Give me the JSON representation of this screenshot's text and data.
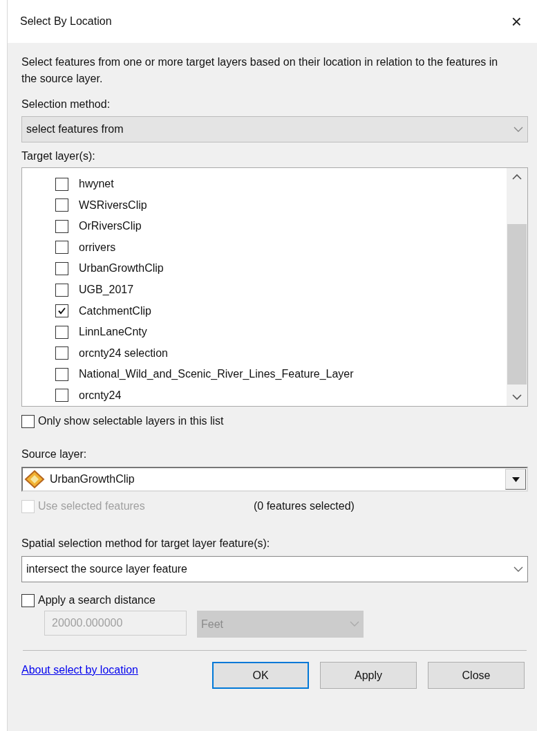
{
  "window": {
    "title": "Select By Location",
    "close": "×"
  },
  "description": "Select features from one or more target layers based on their location in relation to the features in the source layer.",
  "selection_method": {
    "label": "Selection method:",
    "value": "select features from"
  },
  "target_layers": {
    "label": "Target layer(s):",
    "items": [
      {
        "name": "hwynet",
        "checked": false
      },
      {
        "name": "WSRiversClip",
        "checked": false
      },
      {
        "name": "OrRiversClip",
        "checked": false
      },
      {
        "name": "orrivers",
        "checked": false
      },
      {
        "name": "UrbanGrowthClip",
        "checked": false
      },
      {
        "name": "UGB_2017",
        "checked": false
      },
      {
        "name": "CatchmentClip",
        "checked": true
      },
      {
        "name": "LinnLaneCnty",
        "checked": false
      },
      {
        "name": "orcnty24 selection",
        "checked": false
      },
      {
        "name": "National_Wild_and_Scenic_River_Lines_Feature_Layer",
        "checked": false
      },
      {
        "name": "orcnty24",
        "checked": false
      }
    ]
  },
  "only_selectable": {
    "label": "Only show selectable layers in this list",
    "checked": false
  },
  "source_layer": {
    "label": "Source layer:",
    "value": "UrbanGrowthClip"
  },
  "use_selected": {
    "label": "Use selected features",
    "checked": false,
    "disabled": true
  },
  "features_selected": "(0 features selected)",
  "spatial_method": {
    "label": "Spatial selection method for target layer feature(s):",
    "value": "intersect the source layer feature"
  },
  "search_distance": {
    "label": "Apply a search distance",
    "checked": false,
    "value": "20000.000000",
    "unit": "Feet",
    "disabled": true
  },
  "help_link": "About select by location",
  "buttons": [
    {
      "label": "OK",
      "default": true
    },
    {
      "label": "Apply",
      "default": false
    },
    {
      "label": "Close",
      "default": false
    }
  ]
}
